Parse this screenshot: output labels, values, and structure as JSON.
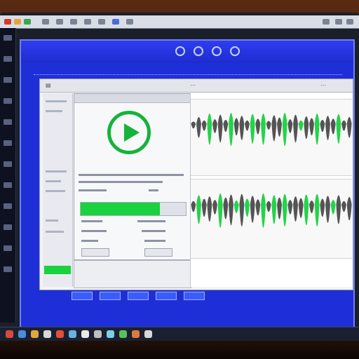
{
  "colors": {
    "app_blue": "#1f2fd8",
    "accent_green": "#16b33a",
    "wave_dark": "#2b2b2b",
    "wave_green": "#16d23e"
  },
  "app": {
    "title": ""
  },
  "dialog": {
    "play_icon": "play-circle-icon",
    "progress_fraction": 0.75
  },
  "tracks": [
    {
      "name": "",
      "peaks": [
        0.2,
        0.6,
        0.3,
        0.9,
        0.4,
        0.8,
        0.35,
        0.95,
        0.5,
        0.7,
        0.3,
        0.85,
        0.45,
        0.9,
        0.25,
        0.75,
        0.55,
        0.95,
        0.4,
        0.8,
        0.3,
        0.65,
        0.5,
        0.9,
        0.35,
        0.7,
        0.45,
        0.85,
        0.3,
        0.6
      ],
      "green_at": [
        3,
        7,
        11,
        13,
        17,
        20,
        23,
        27
      ]
    },
    {
      "name": "",
      "peaks": [
        0.3,
        0.8,
        0.5,
        0.7,
        0.4,
        0.95,
        0.6,
        0.85,
        0.35,
        0.9,
        0.5,
        0.75,
        0.45,
        0.95,
        0.3,
        0.8,
        0.6,
        0.9,
        0.4,
        0.7,
        0.55,
        0.85,
        0.35,
        0.9,
        0.5,
        0.75,
        0.4,
        0.8,
        0.3,
        0.65
      ],
      "green_at": [
        1,
        5,
        8,
        10,
        13,
        15,
        17,
        21,
        23,
        26
      ]
    }
  ],
  "taskbar": {
    "icons": [
      "finder-icon",
      "browser-icon",
      "mail-icon",
      "music-icon",
      "photos-icon",
      "calendar-icon",
      "notes-icon",
      "settings-icon",
      "folder-icon",
      "terminal-icon",
      "chat-icon",
      "store-icon"
    ]
  }
}
